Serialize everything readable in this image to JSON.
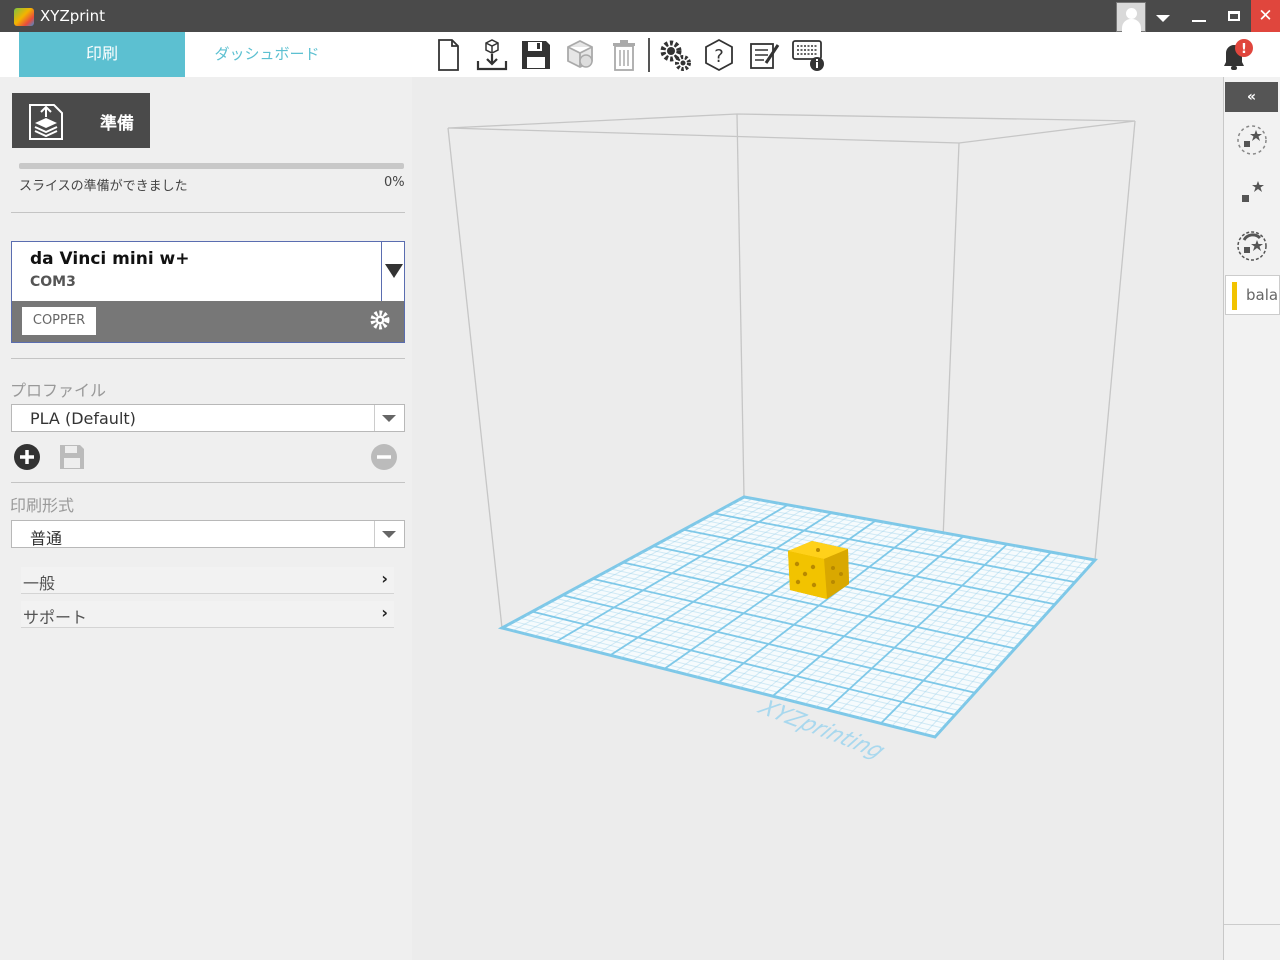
{
  "window": {
    "title": "XYZprint"
  },
  "tabs": {
    "print": "印刷",
    "dashboard": "ダッシュボード"
  },
  "toolbar": {
    "icons": [
      "new-file-icon",
      "import-icon",
      "save-icon",
      "model-info-icon",
      "trash-icon",
      "settings-icon",
      "help-icon",
      "notes-icon",
      "keyboard-info-icon"
    ],
    "notification_badge": "!"
  },
  "prepare": {
    "button_label": "準備",
    "status": "スライスの準備ができました",
    "progress_percent": "0%",
    "progress_value": 0
  },
  "printer": {
    "name": "da Vinci mini w+",
    "port": "COM3",
    "material": "COPPER"
  },
  "profile": {
    "label": "プロファイル",
    "selected": "PLA (Default)"
  },
  "print_mode": {
    "label": "印刷形式",
    "selected": "普通"
  },
  "sections": [
    {
      "label": "一般"
    },
    {
      "label": "サポート"
    }
  ],
  "viewport": {
    "watermark": "XYZprinting"
  },
  "right_panel": {
    "collapse": "«",
    "balance_label": "bala"
  },
  "colors": {
    "accent": "#5cc0d1",
    "titlebar": "#4a4a4a",
    "close": "#e0463d",
    "model": "#f2c300",
    "bed": "#7ec8e8"
  }
}
